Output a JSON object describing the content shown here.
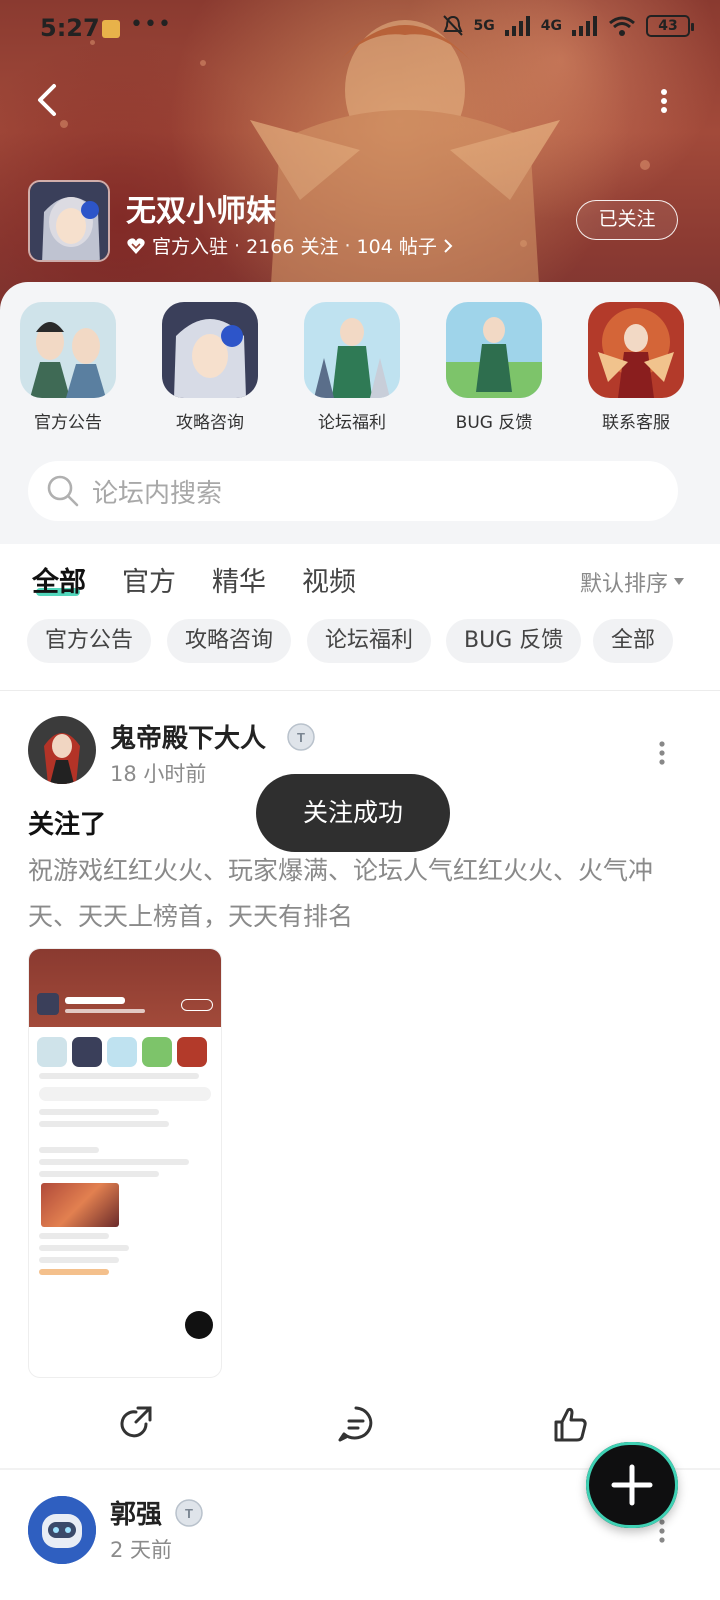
{
  "status_bar": {
    "time": "5:27",
    "dots": "•••",
    "network_1": "5G",
    "network_2": "4G",
    "battery": "43"
  },
  "forum": {
    "title": "无双小师妹",
    "official_label": "官方入驻",
    "followers": "2166 关注",
    "posts": "104 帖子",
    "follow_button": "已关注"
  },
  "sections": [
    {
      "label": "官方公告"
    },
    {
      "label": "攻略咨询"
    },
    {
      "label": "论坛福利"
    },
    {
      "label": "BUG 反馈"
    },
    {
      "label": "联系客服"
    }
  ],
  "search": {
    "placeholder": "论坛内搜索"
  },
  "tabs": {
    "items": [
      "全部",
      "官方",
      "精华",
      "视频"
    ],
    "active": "全部",
    "sort_label": "默认排序"
  },
  "filter_chips": [
    "官方公告",
    "攻略咨询",
    "论坛福利",
    "BUG 反馈",
    "全部"
  ],
  "toast": "关注成功",
  "posts": [
    {
      "author": "鬼帝殿下大人",
      "time": "18 小时前",
      "title": "关注了",
      "body": "祝游戏红红火火、玩家爆满、论坛人气红红火火、火气冲天、天天上榜首，天天有排名"
    },
    {
      "author": "郭强",
      "time": "2 天前"
    }
  ],
  "colors": {
    "accent": "#3fd1b4",
    "banner": "#9a4536",
    "toast_bg": "#2f2f2f"
  }
}
